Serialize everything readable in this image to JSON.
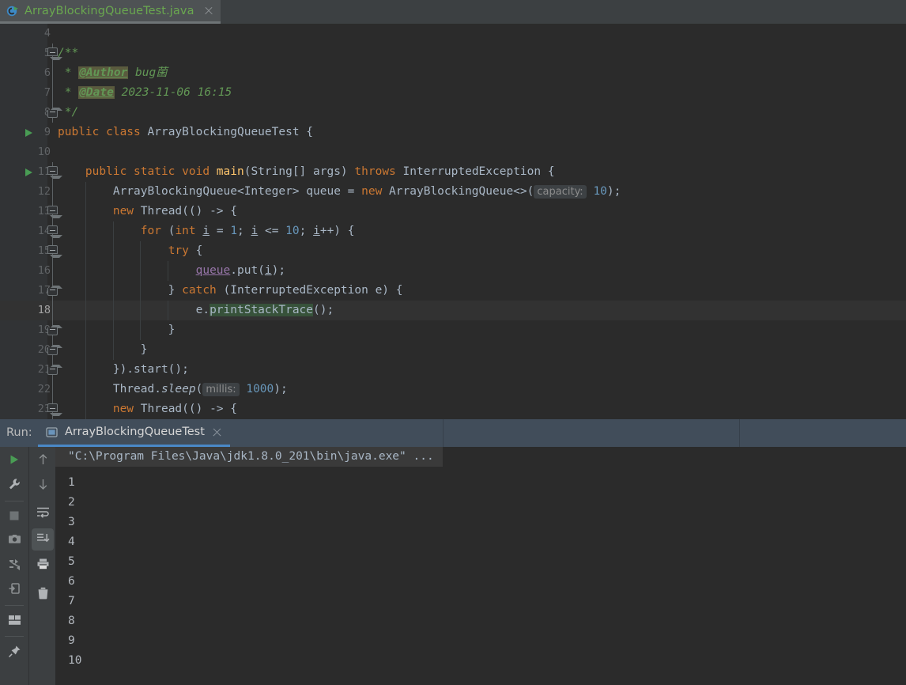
{
  "window": {
    "theme_bg": "#2b2b2b",
    "accent": "#4a88c7"
  },
  "editor_tab": {
    "label": "ArrayBlockingQueueTest.java",
    "icon": "java-runnable-class-icon",
    "close_icon": "close-icon",
    "text_color": "#6aa84f"
  },
  "editor": {
    "caret_line": 18,
    "lines": [
      {
        "n": "4",
        "fold": "",
        "run": false
      },
      {
        "n": "5",
        "fold": "open",
        "run": false
      },
      {
        "n": "6",
        "fold": "",
        "run": false
      },
      {
        "n": "7",
        "fold": "",
        "run": false
      },
      {
        "n": "8",
        "fold": "end",
        "run": false
      },
      {
        "n": "9",
        "fold": "",
        "run": true
      },
      {
        "n": "10",
        "fold": "",
        "run": false
      },
      {
        "n": "11",
        "fold": "open",
        "run": true
      },
      {
        "n": "12",
        "fold": "",
        "run": false
      },
      {
        "n": "13",
        "fold": "open",
        "run": false
      },
      {
        "n": "14",
        "fold": "open",
        "run": false
      },
      {
        "n": "15",
        "fold": "open",
        "run": false
      },
      {
        "n": "16",
        "fold": "",
        "run": false
      },
      {
        "n": "17",
        "fold": "end",
        "run": false
      },
      {
        "n": "18",
        "fold": "",
        "run": false
      },
      {
        "n": "19",
        "fold": "end",
        "run": false
      },
      {
        "n": "20",
        "fold": "end",
        "run": false
      },
      {
        "n": "21",
        "fold": "end",
        "run": false
      },
      {
        "n": "22",
        "fold": "",
        "run": false
      },
      {
        "n": "23",
        "fold": "open",
        "run": false
      }
    ],
    "code": {
      "l4": "",
      "l5": "/**",
      "l6_star": " * ",
      "l6_tag": "@Author",
      "l6_rest": " bug菌",
      "l7_star": " * ",
      "l7_tag": "@Date",
      "l7_rest": " 2023-11-06 16:15",
      "l8": " */",
      "l9_a": "public class ",
      "l9_b": "ArrayBlockingQueueTest {",
      "l11_a": "public static void ",
      "l11_b": "main",
      "l11_c": "(String[] args) ",
      "l11_d": "throws",
      "l11_e": " InterruptedException {",
      "l12_a": "ArrayBlockingQueue<Integer> queue = ",
      "l12_b": "new",
      "l12_c": " ArrayBlockingQueue<>(",
      "l12_hint": "capacity:",
      "l12_num": "10",
      "l12_d": ");",
      "l13_a": "new",
      "l13_b": " Thread(() -> {",
      "l14_a": "for",
      "l14_b": " (",
      "l14_c": "int",
      "l14_d": " ",
      "l14_i1": "i",
      "l14_e": " = ",
      "l14_n1": "1",
      "l14_f": "; ",
      "l14_i2": "i",
      "l14_g": " <= ",
      "l14_n2": "10",
      "l14_h": "; ",
      "l14_i3": "i",
      "l14_j": "++) {",
      "l15_a": "try",
      "l15_b": " {",
      "l16_a": "queue",
      "l16_b": ".put(",
      "l16_i": "i",
      "l16_c": ");",
      "l17_a": "} ",
      "l17_b": "catch",
      "l17_c": " (InterruptedException e) {",
      "l18_a": "e.",
      "l18_hl": "printStackTrace",
      "l18_b": "();",
      "l19": "}",
      "l20": "}",
      "l21": "}).start();",
      "l22_a": "Thread.",
      "l22_b": "sleep",
      "l22_c": "(",
      "l22_hint": "millis:",
      "l22_num": "1000",
      "l22_d": ");",
      "l23_a": "new",
      "l23_b": " Thread(() -> {"
    }
  },
  "run_panel": {
    "title": "Run:",
    "tab": {
      "label": "ArrayBlockingQueueTest",
      "icon": "console-icon",
      "close_icon": "close-icon"
    },
    "toolbar_left": [
      {
        "name": "rerun-button",
        "icon": "play-icon"
      },
      {
        "name": "rerun-failed-button",
        "icon": "wrench-icon"
      },
      {
        "name": "stop-button",
        "icon": "stop-icon"
      },
      {
        "name": "snapshot-button",
        "icon": "camera-icon"
      },
      {
        "name": "thread-dump-button",
        "icon": "thread-dump-icon"
      },
      {
        "name": "exit-button",
        "icon": "exit-icon"
      },
      {
        "name": "layout-button",
        "icon": "layout-icon"
      },
      {
        "name": "pin-button",
        "icon": "pin-icon"
      }
    ],
    "toolbar_right": [
      {
        "name": "up-button",
        "icon": "arrow-up-icon",
        "selected": false
      },
      {
        "name": "down-button",
        "icon": "arrow-down-icon",
        "selected": false
      },
      {
        "name": "soft-wrap-button",
        "icon": "soft-wrap-icon",
        "selected": false
      },
      {
        "name": "scroll-to-end-button",
        "icon": "scroll-to-end-icon",
        "selected": true
      },
      {
        "name": "print-button",
        "icon": "print-icon",
        "selected": false
      },
      {
        "name": "clear-all-button",
        "icon": "trash-icon",
        "selected": false
      }
    ],
    "console": {
      "command": "\"C:\\Program Files\\Java\\jdk1.8.0_201\\bin\\java.exe\" ...",
      "output": [
        "1",
        "2",
        "3",
        "4",
        "5",
        "6",
        "7",
        "8",
        "9",
        "10"
      ]
    }
  }
}
